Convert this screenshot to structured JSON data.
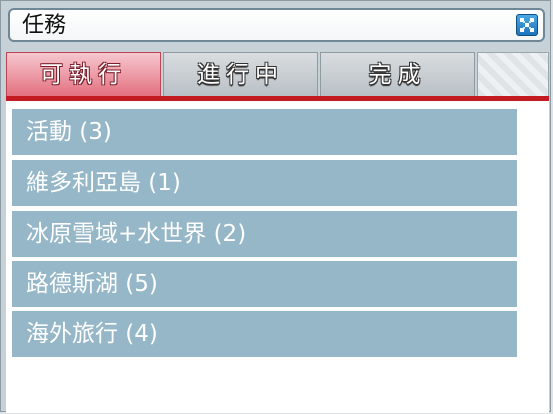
{
  "window": {
    "title": "任務"
  },
  "tabs": [
    {
      "label": "可執行",
      "active": true
    },
    {
      "label": "進行中",
      "active": false
    },
    {
      "label": "完成",
      "active": false
    }
  ],
  "list": [
    {
      "label": "活動 (3)"
    },
    {
      "label": "維多利亞島 (1)"
    },
    {
      "label": "冰原雪域+水世界 (2)"
    },
    {
      "label": "路德斯湖 (5)"
    },
    {
      "label": "海外旅行 (4)"
    }
  ],
  "icons": {
    "close": "close-icon"
  },
  "colors": {
    "active_tab": "#e3707f",
    "accent_line": "#c41a22",
    "list_item_bg": "#95b7c8",
    "close_button": "#1e74b8"
  }
}
